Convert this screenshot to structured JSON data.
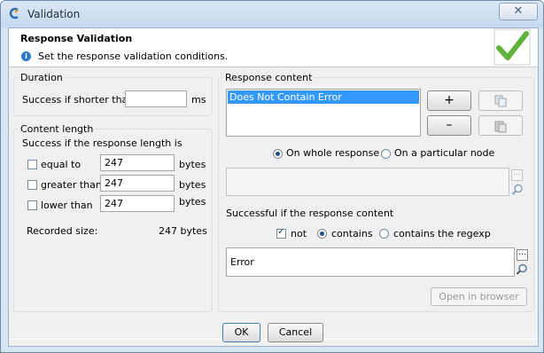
{
  "window": {
    "title": "Validation",
    "close_symbol": "✕"
  },
  "header": {
    "title": "Response Validation",
    "description": "Set the response validation conditions."
  },
  "duration": {
    "group_label": "Duration",
    "label": "Success if shorter than",
    "value": "",
    "unit": "ms"
  },
  "content_length": {
    "group_label": "Content length",
    "subtitle": "Success if the response length is",
    "rows": [
      {
        "label": "equal to",
        "value": "247",
        "unit": "bytes",
        "checked": false
      },
      {
        "label": "greater than",
        "value": "247",
        "unit": "bytes",
        "checked": false
      },
      {
        "label": "lower than",
        "value": "247",
        "unit": "bytes",
        "checked": false
      }
    ],
    "recorded_label": "Recorded size:",
    "recorded_value": "247 bytes"
  },
  "response_content": {
    "group_label": "Response content",
    "list_items": [
      "Does Not Contain Error"
    ],
    "add_symbol": "+",
    "remove_symbol": "–",
    "radio_whole": "On whole response",
    "radio_node": "On a particular node",
    "selected_scope": "On whole response",
    "node_value": "",
    "successful_label": "Successful if the response content",
    "not_label": "not",
    "not_checked": true,
    "contains_label": "contains",
    "regexp_label": "contains the regexp",
    "selected_match": "contains",
    "pattern_value": "Error",
    "ellipsis": "...",
    "open_browser": "Open in browser"
  },
  "footer": {
    "ok": "OK",
    "cancel": "Cancel"
  }
}
